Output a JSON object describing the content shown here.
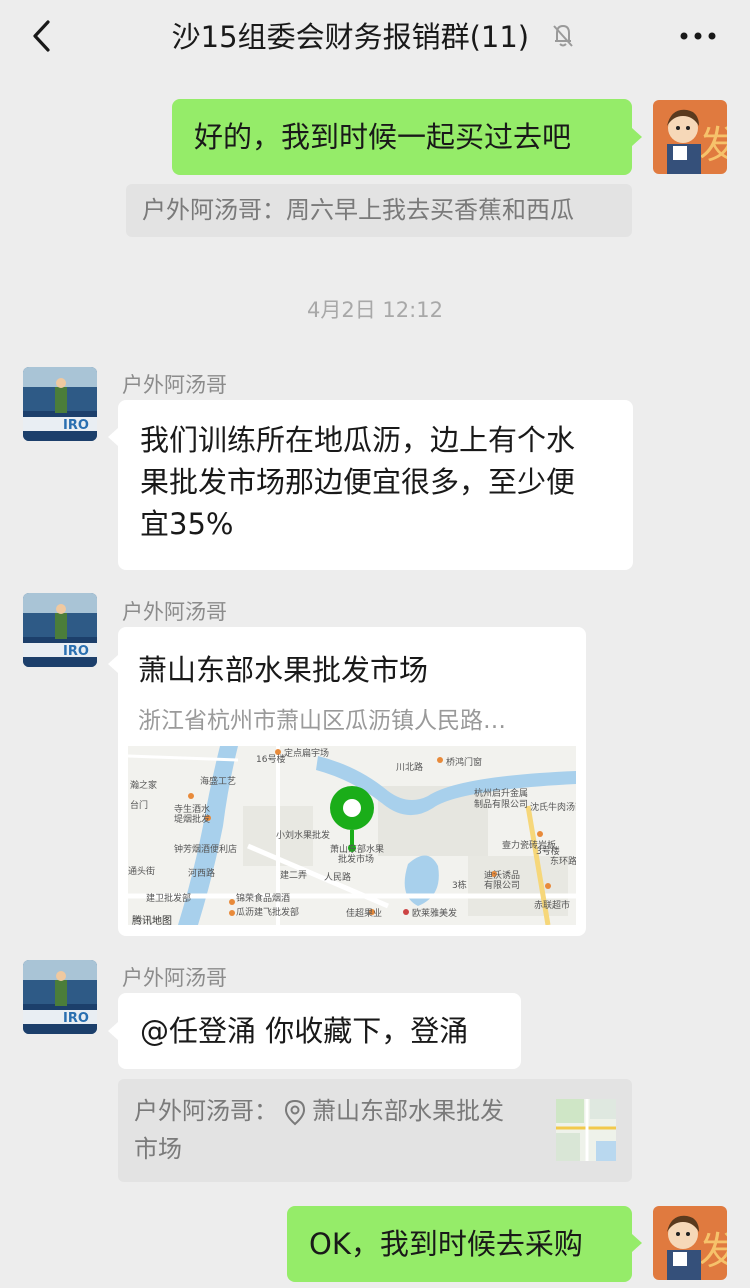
{
  "header": {
    "title": "沙15组委会财务报销群(11)",
    "back_icon": "chevron-left-icon",
    "mute_icon": "bell-off-icon",
    "more_icon": "more-dots-icon"
  },
  "messages": {
    "m1": {
      "text": "好的，我到时候一起买过去吧",
      "quote": "户外阿汤哥：周六早上我去买香蕉和西瓜"
    },
    "timestamp": "4月2日 12:12",
    "m2": {
      "sender": "户外阿汤哥",
      "lines": [
        "我们训练所在地瓜沥，边上有个水",
        "果批发市场那边便宜很多，至少便",
        "宜35%"
      ]
    },
    "m3": {
      "sender": "户外阿汤哥",
      "location_name": "萧山东部水果批发市场",
      "location_address": "浙江省杭州市萧山区瓜沥镇人民路…",
      "map_labels": {
        "l1": "定点扁宇场",
        "l2": "桥鸿门窗",
        "l3": "川北路",
        "l4": "16号楼",
        "l5": "杭州启升金属",
        "l6": "制品有限公司",
        "l7": "沈氏牛肉汤面",
        "l8": "海盛工艺",
        "l9": "瀚之家",
        "l10": "台门",
        "l11": "寺生酒水",
        "l12": "堤烟批发",
        "l13": "小刘水果批发",
        "l14": "萧山东部水果",
        "l15": "批发市场",
        "l16": "钟芳烟酒便利店",
        "l17": "河西路",
        "l18": "通头街",
        "l19": "建卫批发部",
        "l20": "锦荣食品烟酒",
        "l21": "瓜沥建飞批发部",
        "l22": "人民路",
        "l23": "建二弄",
        "l24": "壹力瓷砖岩板",
        "l25": "东环路",
        "l26": "迪沃诱品",
        "l27": "有限公司",
        "l28": "3号楼",
        "l29": "3栋",
        "l30": "赤联超市",
        "l31": "佳超果业",
        "l32": "欧莱雅美发",
        "l33": "腾讯地图"
      }
    },
    "m4": {
      "sender": "户外阿汤哥",
      "text": "@任登涌  你收藏下，登涌",
      "quote_line1": "户外阿汤哥：",
      "quote_loc": "萧山东部水果批发",
      "quote_line2": "市场"
    },
    "m5": {
      "text": "OK，我到时候去采购"
    }
  },
  "colors": {
    "background": "#ededed",
    "green_bubble": "#95ec69",
    "white_bubble": "#ffffff",
    "map_pin": "#1aad19"
  }
}
